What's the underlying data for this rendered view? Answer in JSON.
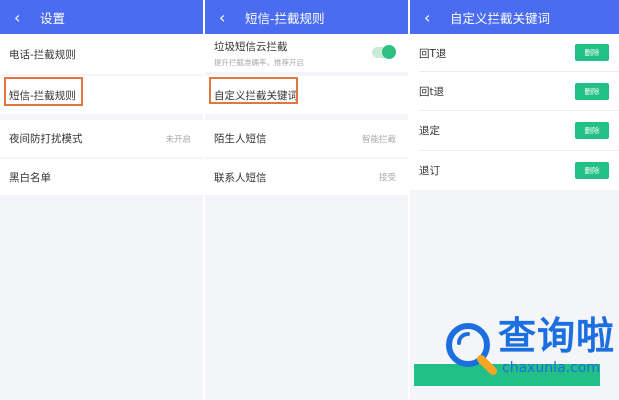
{
  "screens": [
    {
      "title": "设置",
      "rows": [
        {
          "label": "电话-拦截规则",
          "value": ""
        },
        {
          "label": "短信-拦截规则",
          "value": ""
        },
        {
          "label": "夜间防打扰模式",
          "value": "未开启"
        },
        {
          "label": "黑白名单",
          "value": ""
        }
      ]
    },
    {
      "title": "短信-拦截规则",
      "cloud_filter": {
        "label": "垃圾短信云拦截",
        "subtitle": "提升拦截准确率，推荐开启",
        "enabled": true
      },
      "rows": [
        {
          "label": "自定义拦截关键词",
          "value": ""
        },
        {
          "label": "陌生人短信",
          "value": "智能拦截"
        },
        {
          "label": "联系人短信",
          "value": "接受"
        }
      ]
    },
    {
      "title": "自定义拦截关键词",
      "keywords": [
        {
          "label": "回T退",
          "action": "删除"
        },
        {
          "label": "回t退",
          "action": "删除"
        },
        {
          "label": "退定",
          "action": "删除"
        },
        {
          "label": "退订",
          "action": "删除"
        }
      ]
    }
  ],
  "icons": {
    "back": "chevron-left-icon"
  },
  "watermark": {
    "name": "查询啦",
    "domain": "chaxunla.com"
  },
  "colors": {
    "header": "#4a6cf0",
    "highlight": "#e0773d",
    "delete_button": "#22bf86",
    "toggle": "#2cc083",
    "watermark": "#1c6fe0"
  }
}
